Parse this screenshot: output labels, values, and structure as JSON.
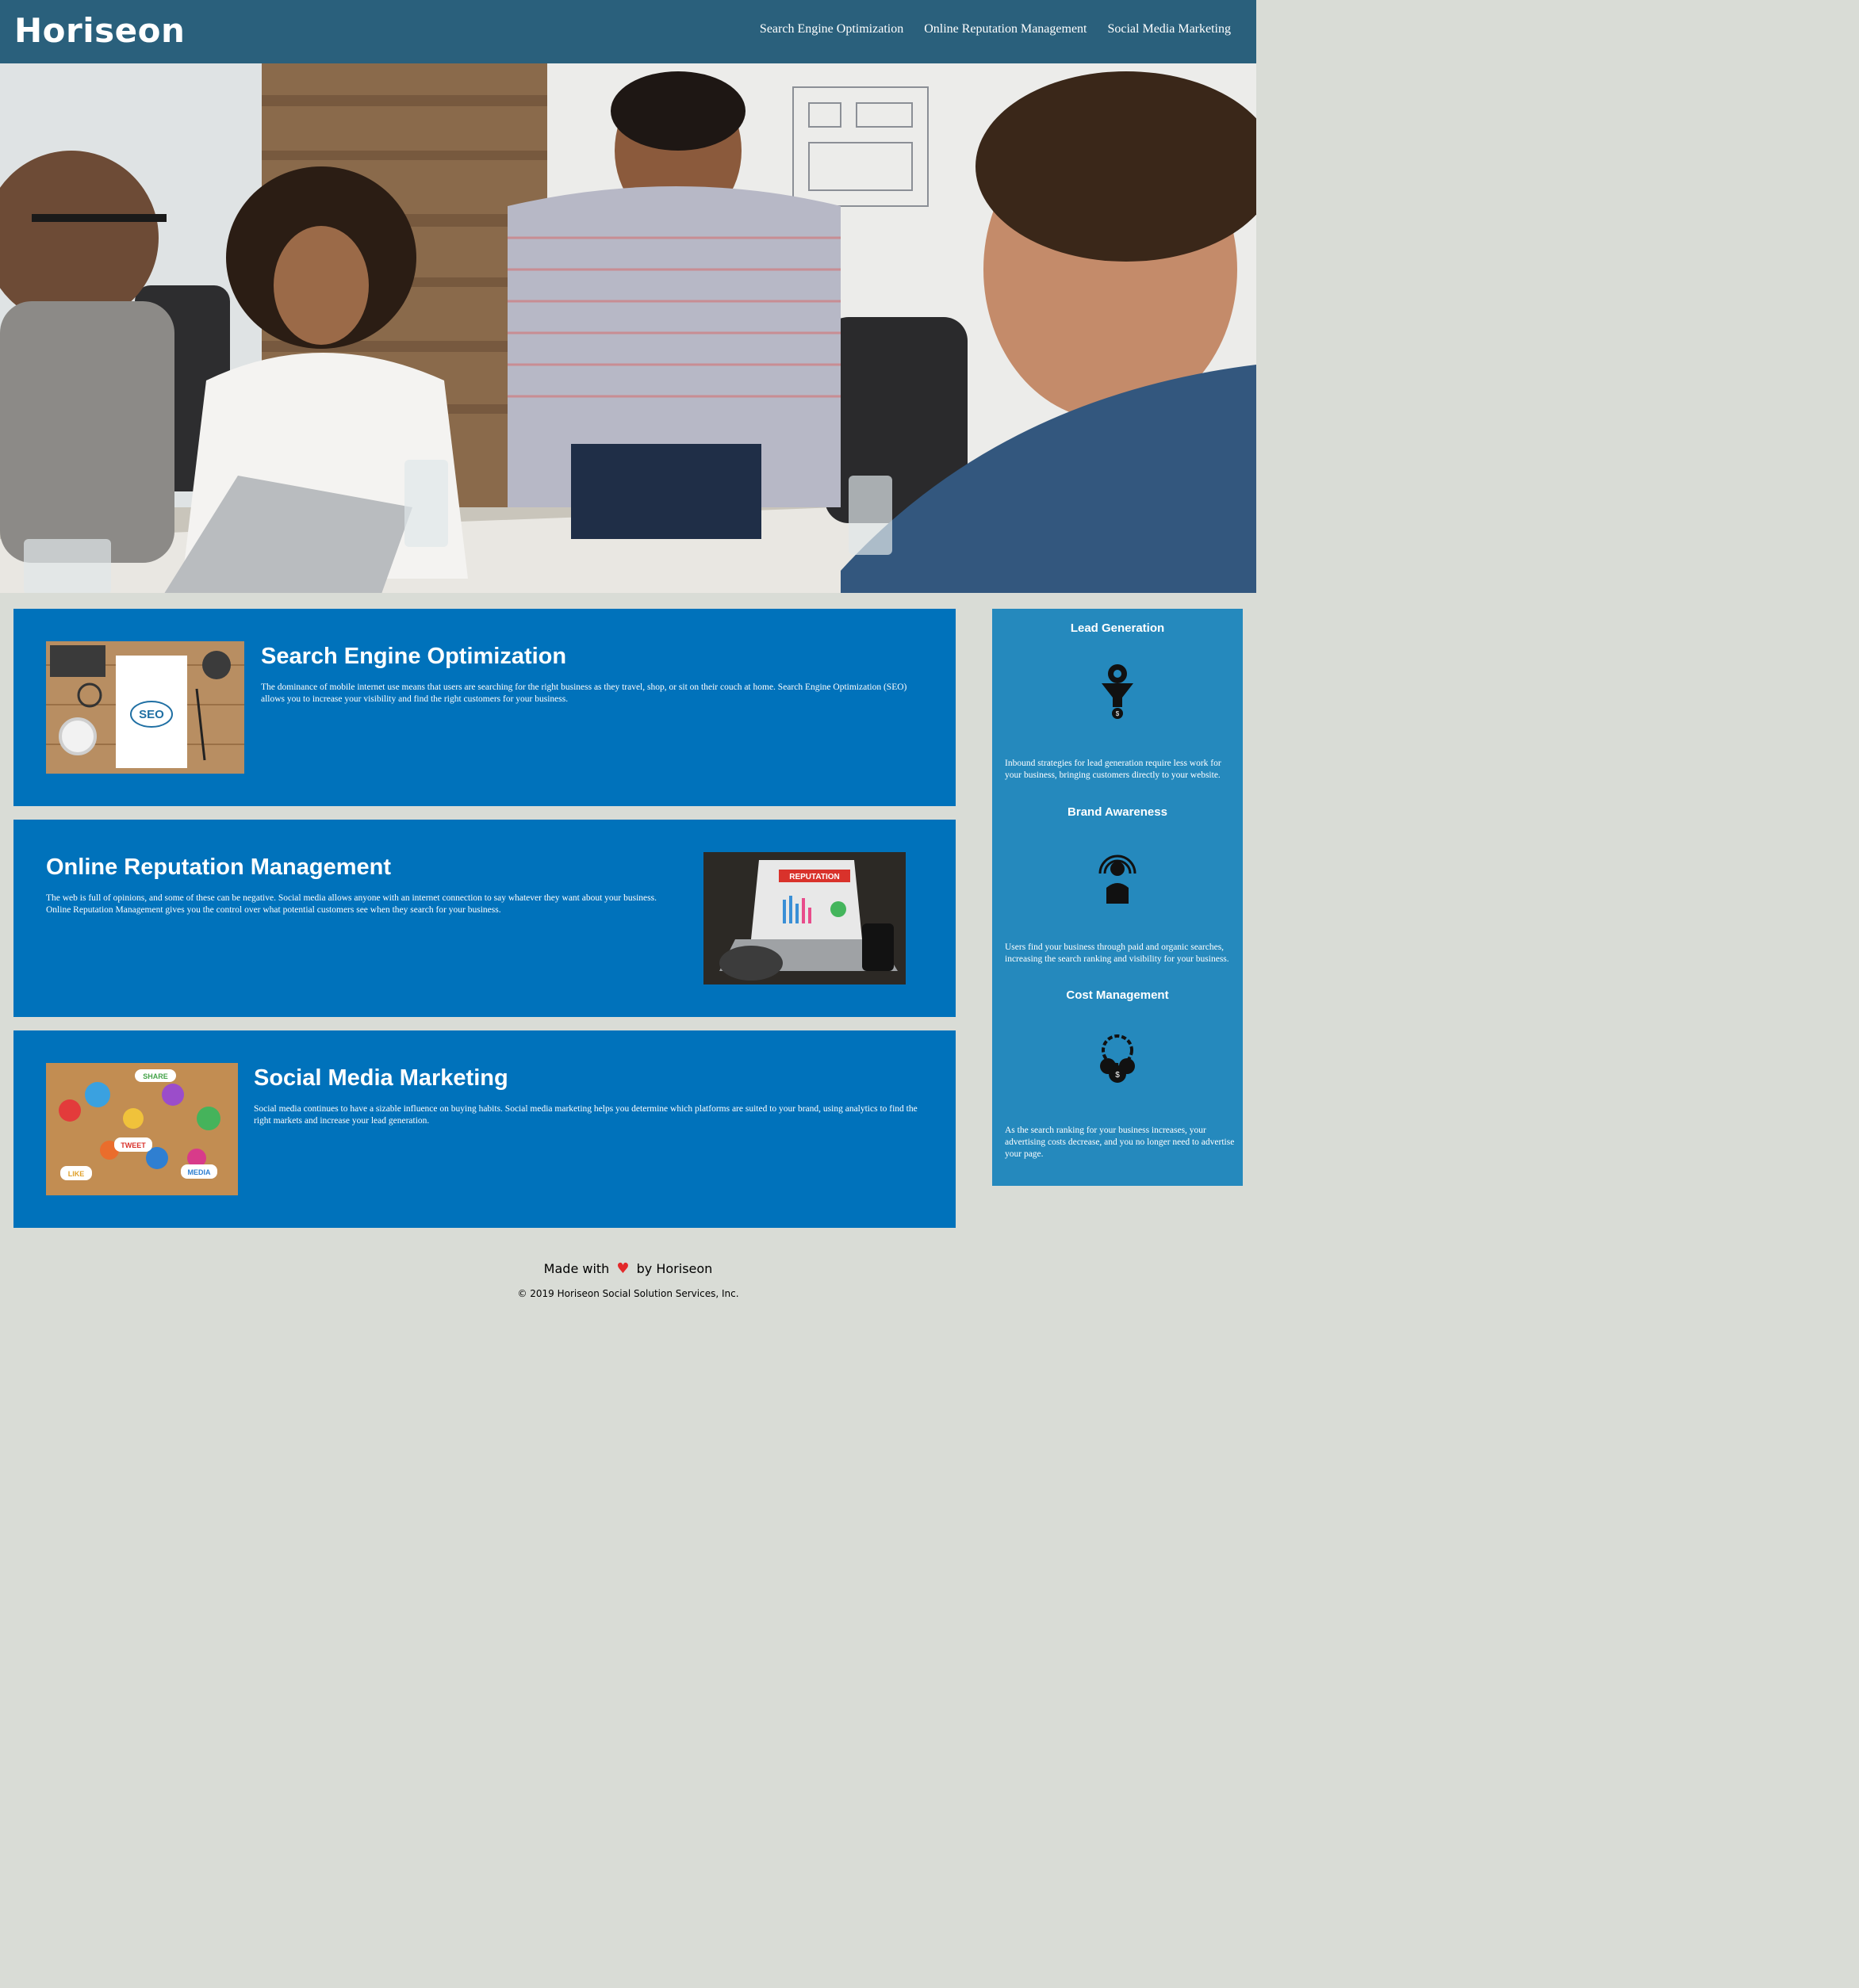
{
  "header": {
    "logo": "Horiseon",
    "nav": [
      {
        "label": "Search Engine Optimization"
      },
      {
        "label": "Online Reputation Management"
      },
      {
        "label": "Social Media Marketing"
      }
    ],
    "background": "#2a607c"
  },
  "hero": {
    "description_icon": "team-meeting-photo"
  },
  "content": {
    "card_color": "#0072bb",
    "cards": [
      {
        "title": "Search Engine Optimization",
        "text": "The dominance of mobile internet use means that users are searching for the right business as they travel, shop, or sit on their couch at home. Search Engine Optimization (SEO) allows you to increase your visibility and find the right customers for your business.",
        "image_label": "SEO"
      },
      {
        "title": "Online Reputation Management",
        "text": "The web is full of opinions, and some of these can be negative. Social media allows anyone with an internet connection to say whatever they want about your business. Online Reputation Management gives you the control over what potential customers see when they search for your business.",
        "image_label": "REPUTATION"
      },
      {
        "title": "Social Media Marketing",
        "text": "Social media continues to have a sizable influence on buying habits. Social media marketing helps you determine which platforms are suited to your brand, using analytics to find the right markets and increase your lead generation.",
        "image_labels": [
          "SHARE",
          "TWEET",
          "LIKE",
          "MEDIA"
        ]
      }
    ]
  },
  "aside": {
    "color": "#2589bd",
    "benefits": [
      {
        "title": "Lead Generation",
        "icon": "lead-funnel-icon",
        "text": "Inbound strategies for lead generation require less work for your business, bringing customers directly to your website."
      },
      {
        "title": "Brand Awareness",
        "icon": "brand-broadcast-icon",
        "text": "Users find your business through paid and organic searches, increasing the search ranking and visibility for your business."
      },
      {
        "title": "Cost Management",
        "icon": "cost-gears-icon",
        "text": "As the search ranking for your business increases, your advertising costs decrease, and you no longer need to advertise your page."
      }
    ]
  },
  "footer": {
    "made_with": "Made with",
    "by": "by Horiseon",
    "heart": "♥",
    "copyright": "© 2019 Horiseon Social Solution Services, Inc."
  }
}
